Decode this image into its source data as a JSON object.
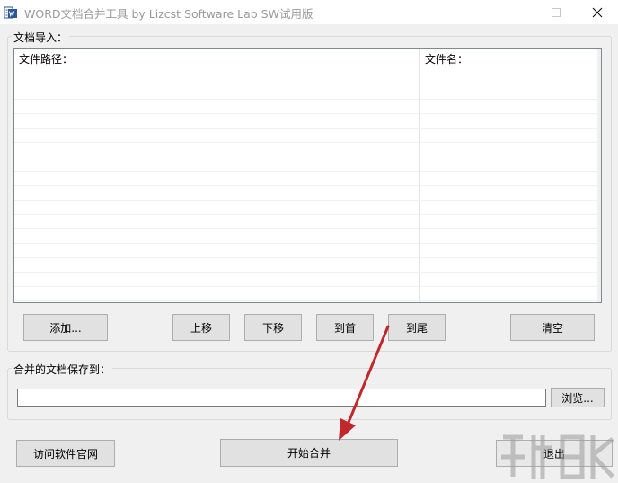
{
  "window": {
    "title": "WORD文档合并工具    by Lizcst Software Lab   SW试用版"
  },
  "import_group": {
    "label": "文档导入：",
    "columns": [
      "文件路径：",
      "文件名："
    ],
    "rows": []
  },
  "buttons": {
    "add": "添加...",
    "move_up": "上移",
    "move_down": "下移",
    "to_top": "到首",
    "to_bottom": "到尾",
    "clear": "清空",
    "browse": "浏览...",
    "visit_site": "访问软件官网",
    "start_merge": "开始合并",
    "exit": "退出"
  },
  "save_group": {
    "label": "合并的文档保存到：",
    "path_value": ""
  },
  "colors": {
    "annotation_arrow": "#c0282c"
  }
}
